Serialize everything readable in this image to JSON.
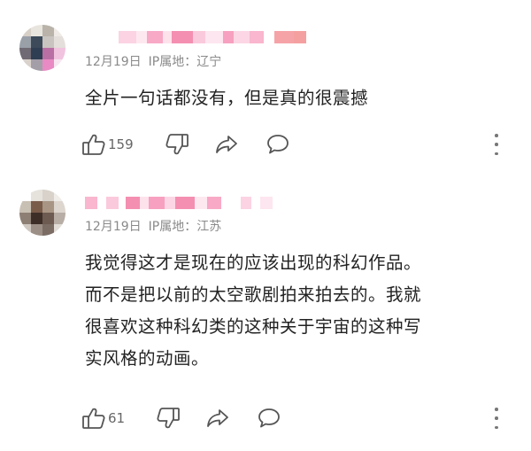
{
  "comments": [
    {
      "date": "12月19日",
      "ip_label": "IP属地：",
      "location": "辽宁",
      "lines": [
        "全片一句话都没有，但是真的很震撼"
      ],
      "likes": "159",
      "icons": [
        "thumbs-up-icon",
        "thumbs-down-icon",
        "share-icon",
        "reply-icon",
        "more-icon"
      ]
    },
    {
      "date": "12月19日",
      "ip_label": "IP属地：",
      "location": "江苏",
      "lines": [
        "我觉得这才是现在的应该出现的科幻作品。",
        "而不是把以前的太空歌剧拍来拍去的。我就",
        "很喜欢这种科幻类的这种关于宇宙的这种写",
        "实风格的动画。"
      ],
      "likes": "61",
      "icons": [
        "thumbs-up-icon",
        "thumbs-down-icon",
        "share-icon",
        "reply-icon",
        "more-icon"
      ]
    }
  ],
  "colors": {
    "meta_gray": "#8a8a8a",
    "text": "#222222",
    "icon": "#555555",
    "username_pink": "#f48fb1"
  }
}
